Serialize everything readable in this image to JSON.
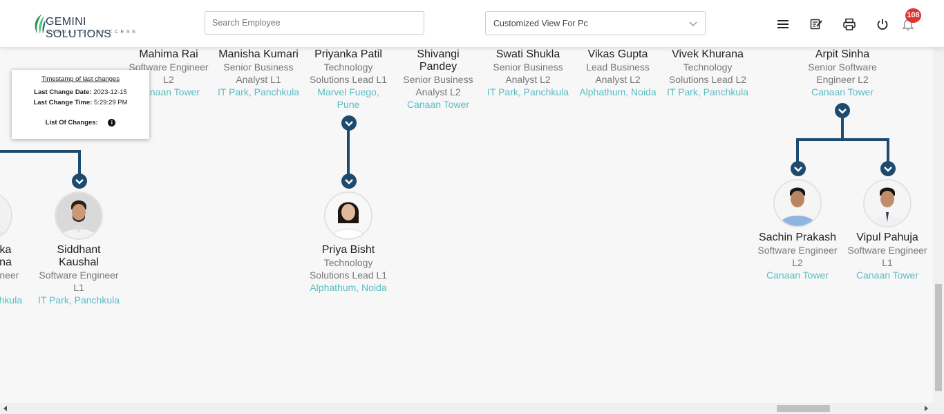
{
  "header": {
    "logo_main": "GEMINI SOLUTIONS",
    "logo_tagline": "VISUALIZE SUCCESS",
    "search_placeholder": "Search Employee",
    "view_select": "Customized View For Pc",
    "notification_count": "108",
    "icons": [
      "menu-icon",
      "edit-note-icon",
      "print-icon",
      "power-icon",
      "bell-icon"
    ]
  },
  "changes_card": {
    "title": "Timestamp of last changes",
    "date_label": "Last Change Date:",
    "date_value": "2023-12-15",
    "time_label": "Last Change Time:",
    "time_value": "5:29:29 PM",
    "list_label": "List Of Changes:"
  },
  "top_row": [
    {
      "name": "Mahima Rai",
      "role_line1": "Software Engineer",
      "role_line2": "L2",
      "location": "Canaan Tower"
    },
    {
      "name": "Manisha Kumari",
      "role_line1": "Senior Business",
      "role_line2": "Analyst L1",
      "location": "IT Park, Panchkula"
    },
    {
      "name": "Priyanka Patil",
      "role_line1": "Technology",
      "role_line2": "Solutions Lead L1",
      "location_line1": "Marvel Fuego,",
      "location_line2": "Pune"
    },
    {
      "name_line1": "Shivangi",
      "name_line2": "Pandey",
      "role_line1": "Senior Business",
      "role_line2": "Analyst L2",
      "location": "Canaan Tower"
    },
    {
      "name": "Swati Shukla",
      "role_line1": "Senior Business",
      "role_line2": "Analyst L2",
      "location": "IT Park, Panchkula"
    },
    {
      "name": "Vikas Gupta",
      "role_line1": "Lead Business",
      "role_line2": "Analyst L2",
      "location": "Alphathum, Noida"
    },
    {
      "name": "Vivek Khurana",
      "role_line1": "Technology",
      "role_line2": "Solutions Lead L2",
      "location": "IT Park, Panchkula"
    },
    {
      "name": "Arpit Sinha",
      "role_line1": "Senior Software",
      "role_line2": "Engineer L2",
      "location": "Canaan Tower"
    }
  ],
  "children": [
    {
      "name_line1": "ka",
      "name_line2": "na",
      "role_line1": "gineer",
      "location": "nchkula"
    },
    {
      "name_line1": "Siddhant",
      "name_line2": "Kaushal",
      "role_line1": "Software Engineer",
      "role_line2": "L1",
      "location": "IT Park, Panchkula"
    },
    {
      "name": "Priya Bisht",
      "role_line1": "Technology",
      "role_line2": "Solutions Lead L1",
      "location": "Alphathum, Noida"
    },
    {
      "name": "Sachin Prakash",
      "role_line1": "Software Engineer",
      "role_line2": "L2",
      "location": "Canaan Tower"
    },
    {
      "name": "Vipul Pahuja",
      "role_line1": "Software Engineer",
      "role_line2": "L1",
      "location": "Canaan Tower"
    }
  ],
  "colors": {
    "connector": "#1e4a6e",
    "location": "#5bbcc4",
    "badge": "#e0322f"
  }
}
